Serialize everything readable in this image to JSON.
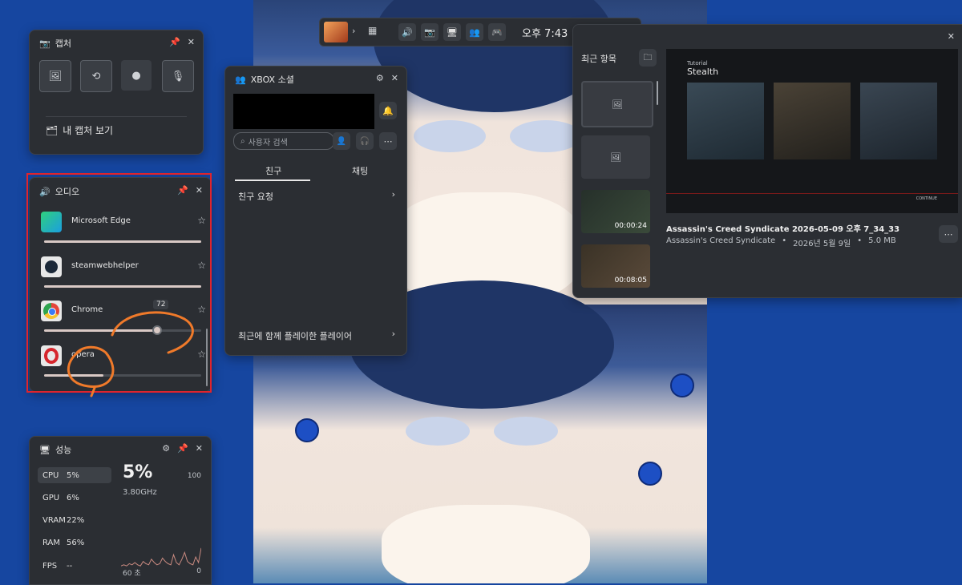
{
  "capture": {
    "title": "캡처",
    "view_captures": "내 캡처 보기"
  },
  "audio": {
    "title": "오디오",
    "apps": [
      {
        "name": "Microsoft Edge",
        "volume": 100,
        "icon": "edge-icon",
        "color": "#1b9ee0"
      },
      {
        "name": "steamwebhelper",
        "volume": 100,
        "icon": "steam-icon",
        "color": "#1b2838"
      },
      {
        "name": "Chrome",
        "volume": 72,
        "icon": "chrome-icon",
        "color": "#e5453a"
      },
      {
        "name": "opera",
        "volume": 38,
        "icon": "opera-icon",
        "color": "#d6262d"
      }
    ],
    "chrome_tooltip": "72"
  },
  "performance": {
    "title": "성능",
    "rows": [
      {
        "label": "CPU",
        "value": "5%"
      },
      {
        "label": "GPU",
        "value": "6%"
      },
      {
        "label": "VRAM",
        "value": "22%"
      },
      {
        "label": "RAM",
        "value": "56%"
      },
      {
        "label": "FPS",
        "value": "--"
      }
    ],
    "big_value": "5%",
    "freq": "3.80GHz",
    "max": "100",
    "min": "0",
    "time_axis": "60 초",
    "graph": [
      2,
      3,
      2,
      4,
      3,
      5,
      3,
      2,
      6,
      4,
      3,
      8,
      5,
      3,
      4,
      9,
      6,
      4,
      3,
      12,
      5,
      3,
      8,
      14,
      6,
      4,
      3,
      10,
      5,
      18
    ]
  },
  "topbar": {
    "time": "오후 7:43"
  },
  "social": {
    "title": "XBOX 소셜",
    "search_placeholder": "사용자 검색",
    "tab_friends": "친구",
    "tab_chat": "채팅",
    "friend_requests": "친구 요청",
    "recent_players": "최근에 함께 플레이한 플레이어"
  },
  "gallery": {
    "recent_label": "최근 항목",
    "thumb_durations": [
      "00:00:24",
      "00:08:05"
    ],
    "preview_tutorial": "Tutorial",
    "preview_title": "Stealth",
    "preview_continue": "CONTINUE",
    "file_title": "Assassin's Creed Syndicate 2026-05-09 오후 7_34_33",
    "game": "Assassin's Creed Syndicate",
    "date": "2026년 5월 9일",
    "size": "5.0 MB"
  },
  "colors": {
    "accent_red": "#e0242c",
    "annotation_orange": "#f07a2a",
    "panel_bg": "#2b2e33"
  }
}
